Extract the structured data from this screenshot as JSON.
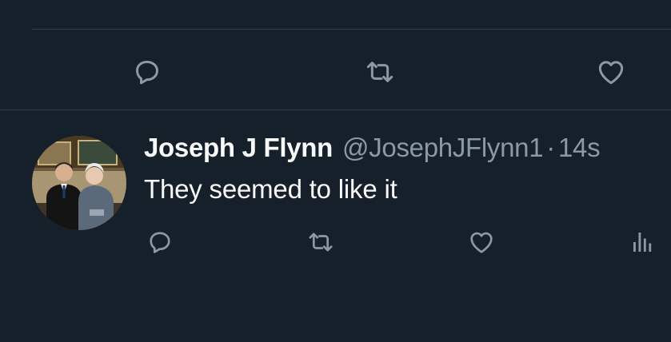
{
  "colors": {
    "background": "#15202b",
    "divider": "#2f3b47",
    "primary_text": "#f7f9f9",
    "secondary_text": "#8b98a5"
  },
  "previous_tweet": {
    "actions": [
      {
        "icon": "reply-icon"
      },
      {
        "icon": "retweet-icon"
      },
      {
        "icon": "like-icon"
      }
    ]
  },
  "tweet": {
    "display_name": "Joseph J Flynn",
    "handle": "@JosephJFlynn1",
    "separator": "·",
    "timestamp": "14s",
    "text": "They seemed to like it",
    "avatar_icon": "profile-photo",
    "actions": [
      {
        "icon": "reply-icon"
      },
      {
        "icon": "retweet-icon"
      },
      {
        "icon": "like-icon"
      },
      {
        "icon": "views-icon"
      }
    ]
  }
}
